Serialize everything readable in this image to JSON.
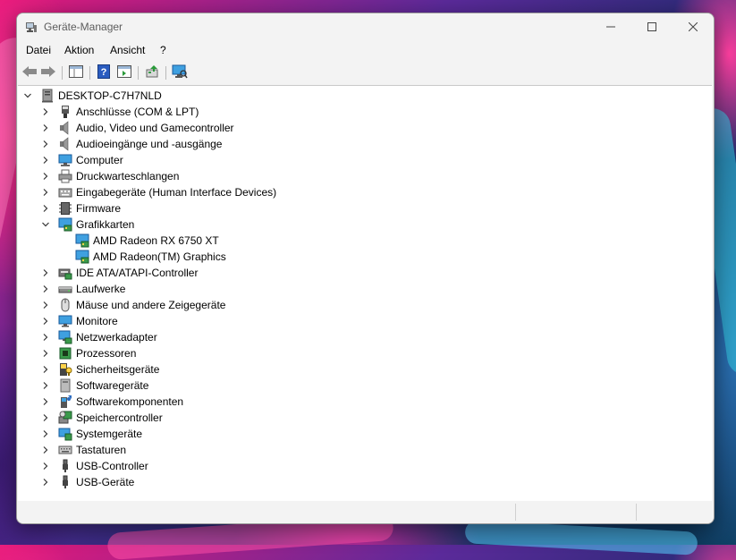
{
  "window": {
    "title": "Geräte-Manager"
  },
  "menubar": {
    "items": [
      "Datei",
      "Aktion",
      "Ansicht",
      "?"
    ]
  },
  "toolbar": {
    "buttons": [
      {
        "name": "back-button",
        "icon": "back-arrow-icon"
      },
      {
        "name": "forward-button",
        "icon": "forward-arrow-icon"
      },
      {
        "name": "show-hide-console-tree-button",
        "icon": "console-tree-icon"
      },
      {
        "name": "help-button",
        "icon": "help-icon"
      },
      {
        "name": "action-pane-button",
        "icon": "action-pane-icon"
      },
      {
        "name": "update-driver-button",
        "icon": "update-driver-icon"
      },
      {
        "name": "scan-hardware-button",
        "icon": "monitor-scan-icon"
      }
    ]
  },
  "tree": {
    "root": "DESKTOP-C7H7NLD",
    "categories": [
      {
        "label": "Anschlüsse (COM & LPT)",
        "icon": "port-icon",
        "expanded": false
      },
      {
        "label": "Audio, Video und Gamecontroller",
        "icon": "speaker-icon",
        "expanded": false
      },
      {
        "label": "Audioeingänge und -ausgänge",
        "icon": "speaker-icon",
        "expanded": false
      },
      {
        "label": "Computer",
        "icon": "computer-icon",
        "expanded": false
      },
      {
        "label": "Druckwarteschlangen",
        "icon": "printer-icon",
        "expanded": false
      },
      {
        "label": "Eingabegeräte (Human Interface Devices)",
        "icon": "hid-icon",
        "expanded": false
      },
      {
        "label": "Firmware",
        "icon": "firmware-icon",
        "expanded": false
      },
      {
        "label": "Grafikkarten",
        "icon": "display-adapter-icon",
        "expanded": true,
        "children": [
          "AMD Radeon RX 6750 XT",
          "AMD Radeon(TM) Graphics"
        ]
      },
      {
        "label": "IDE ATA/ATAPI-Controller",
        "icon": "ide-controller-icon",
        "expanded": false
      },
      {
        "label": "Laufwerke",
        "icon": "drive-icon",
        "expanded": false
      },
      {
        "label": "Mäuse und andere Zeigegeräte",
        "icon": "mouse-icon",
        "expanded": false
      },
      {
        "label": "Monitore",
        "icon": "monitor-icon",
        "expanded": false
      },
      {
        "label": "Netzwerkadapter",
        "icon": "network-adapter-icon",
        "expanded": false
      },
      {
        "label": "Prozessoren",
        "icon": "processor-icon",
        "expanded": false
      },
      {
        "label": "Sicherheitsgeräte",
        "icon": "security-device-icon",
        "expanded": false
      },
      {
        "label": "Softwaregeräte",
        "icon": "software-device-icon",
        "expanded": false
      },
      {
        "label": "Softwarekomponenten",
        "icon": "software-component-icon",
        "expanded": false
      },
      {
        "label": "Speichercontroller",
        "icon": "storage-controller-icon",
        "expanded": false
      },
      {
        "label": "Systemgeräte",
        "icon": "system-device-icon",
        "expanded": false
      },
      {
        "label": "Tastaturen",
        "icon": "keyboard-icon",
        "expanded": false
      },
      {
        "label": "USB-Controller",
        "icon": "usb-icon",
        "expanded": false
      },
      {
        "label": "USB-Geräte",
        "icon": "usb-icon",
        "expanded": false
      }
    ]
  }
}
